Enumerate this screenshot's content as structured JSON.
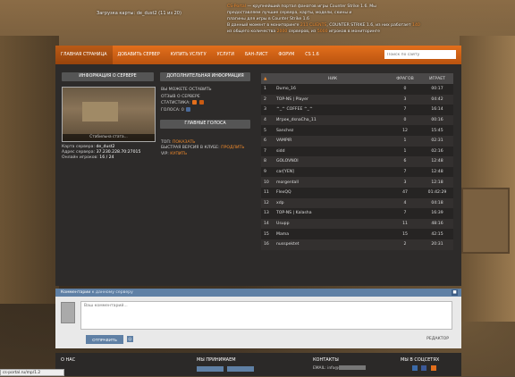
{
  "header": {
    "left_text": "Загрузка карты: de_dust2 (11 из 20)",
    "right_line1_hl": "CS-Portal",
    "right_line1": " — крупнейший портал фанатов игры Counter Strike 1.6. Мы",
    "right_line2": "предоставляем лучшие сервера, карты, модели, скины и",
    "right_line3": "плагины для игры в Counter Strike 1.6",
    "right_line4_a": "В данный момент в мониторинге ",
    "right_line4_hl": "211 CLIENTS",
    "right_line4_b": ", COUNTER STRIKE 1.6, из них работает ",
    "right_line4_hl2": "140",
    "right_line5_a": "из общего количества ",
    "right_line5_hl": "2000",
    "right_line5_b": " серверов, из ",
    "right_line5_hl2": "5000",
    "right_line5_c": " игроков в мониторинге"
  },
  "nav": {
    "items": [
      "ГЛАВНАЯ СТРАНИЦА",
      "ДОБАВИТЬ СЕРВЕР",
      "КУПИТЬ УСЛУГУ",
      "УСЛУГИ",
      "БАН-ЛИСТ",
      "ФОРУМ",
      "CS 1.6"
    ],
    "search_placeholder": "Поиск по сайту"
  },
  "server": {
    "info_label": "ИНФОРМАЦИЯ О СЕРВЕРЕ",
    "extra_label": "ДОПОЛНИТЕЛЬНАЯ ИНФОРМАЦИЯ",
    "map_caption": "Cтабильна стата...",
    "map_label": "Карта сервера:",
    "map_value": "de_dust2",
    "addr_label": "Адрес сервера:",
    "addr_value": "37.230.228.70:27015",
    "players_label": "Онлайн игроков:",
    "players_value": "16 / 24",
    "mid_line1": "ВЫ МОЖЕТЕ ОСТАВИТЬ",
    "mid_line2": "ОТЗЫВ О СЕРВЕРЕ",
    "stats_label": "СТАТИСТИКА:",
    "votes_label": "ГОЛОСА:",
    "votes_value": "0",
    "online_btn": "ГЛАВНЫЕ ГОЛОСА",
    "top_label": "ТОП:",
    "top_value": "ПОКАЗАТЬ",
    "fast_label": "БЫСТРАЯ ВЕРСИЯ В КЛУБЕ:",
    "fast_value": "ПРОДЛИТЬ",
    "vip_label": "VIP:",
    "vip_value": "КУПИТЬ"
  },
  "table": {
    "headers": [
      "",
      "НИК",
      "ФРАГОВ",
      "ИГРАЕТ"
    ],
    "rows": [
      {
        "n": "1",
        "nick": "Dumo_16",
        "frags": "0",
        "time": "00:17"
      },
      {
        "n": "2",
        "nick": "TOP-NS | Player",
        "frags": "3",
        "time": "04:42"
      },
      {
        "n": "3",
        "nick": "^_^ COFFEE ^_^",
        "frags": "7",
        "time": "16:14"
      },
      {
        "n": "4",
        "nick": "Игрок_dsnaCha_11",
        "frags": "0",
        "time": "00:16"
      },
      {
        "n": "5",
        "nick": "Sanchez",
        "frags": "12",
        "time": "15:45"
      },
      {
        "n": "6",
        "nick": "VAMPIR",
        "frags": "1",
        "time": "02:31"
      },
      {
        "n": "7",
        "nick": "sidd",
        "frags": "1",
        "time": "02:16"
      },
      {
        "n": "8",
        "nick": "GOLOVNOI",
        "frags": "6",
        "time": "12:48"
      },
      {
        "n": "9",
        "nick": "car[YEN]",
        "frags": "7",
        "time": "12:48"
      },
      {
        "n": "10",
        "nick": "morgentall",
        "frags": "3",
        "time": "12:18"
      },
      {
        "n": "11",
        "nick": "FlexQQ",
        "frags": "47",
        "time": "01:42:29"
      },
      {
        "n": "12",
        "nick": "xdp",
        "frags": "4",
        "time": "04:18"
      },
      {
        "n": "13",
        "nick": "TOP-NS | Kalasha",
        "frags": "7",
        "time": "16:39"
      },
      {
        "n": "14",
        "nick": "Usupp",
        "frags": "11",
        "time": "48:16"
      },
      {
        "n": "15",
        "nick": "Mama",
        "frags": "15",
        "time": "42:15"
      },
      {
        "n": "16",
        "nick": "nusspektet",
        "frags": "2",
        "time": "20:31"
      }
    ]
  },
  "comments": {
    "title": "Комментарии",
    "subtitle": "к данному серверу",
    "placeholder": "Ваш комментарий...",
    "send_label": "ОТПРАВИТЬ",
    "right_label": "РЕДАКТОР"
  },
  "footer": {
    "about": "О НАС",
    "accept": "МЫ ПРИНИМАЕМ",
    "contacts": "КОНТАКТЫ",
    "email_label": "EMAIL: info@",
    "social": "МЫ В СОЦСЕТЯХ"
  },
  "statusbar": "cs-portal.ru/mp/1.2",
  "colors": {
    "accent": "#e36f1c",
    "blue": "#5f80a5"
  }
}
